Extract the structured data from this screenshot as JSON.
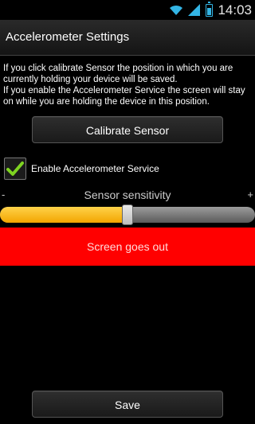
{
  "status_bar": {
    "time": "14:03"
  },
  "titlebar": {
    "title": "Accelerometer Settings"
  },
  "description": {
    "line1": "If you click calibrate Sensor the position in which you are currently holding your device will be saved.",
    "line2": "If you enable the Accelerometer Service the screen will stay on while you are holding the device in this position."
  },
  "calibrate_button": {
    "label": "Calibrate Sensor"
  },
  "enable_service": {
    "label": "Enable Accelerometer Service",
    "checked": true
  },
  "sensitivity": {
    "label": "Sensor sensitivity",
    "minus": "-",
    "plus": "+",
    "value_fraction": 0.5
  },
  "screen_status": {
    "label": "Screen goes out",
    "color": "#ff0000"
  },
  "save_button": {
    "label": "Save"
  },
  "colors": {
    "accent": "#33b5e5",
    "slider_fill": "#f7b500",
    "check": "#7ed321"
  },
  "icons": [
    "wifi-icon",
    "signal-icon",
    "battery-icon",
    "checkmark-icon"
  ]
}
